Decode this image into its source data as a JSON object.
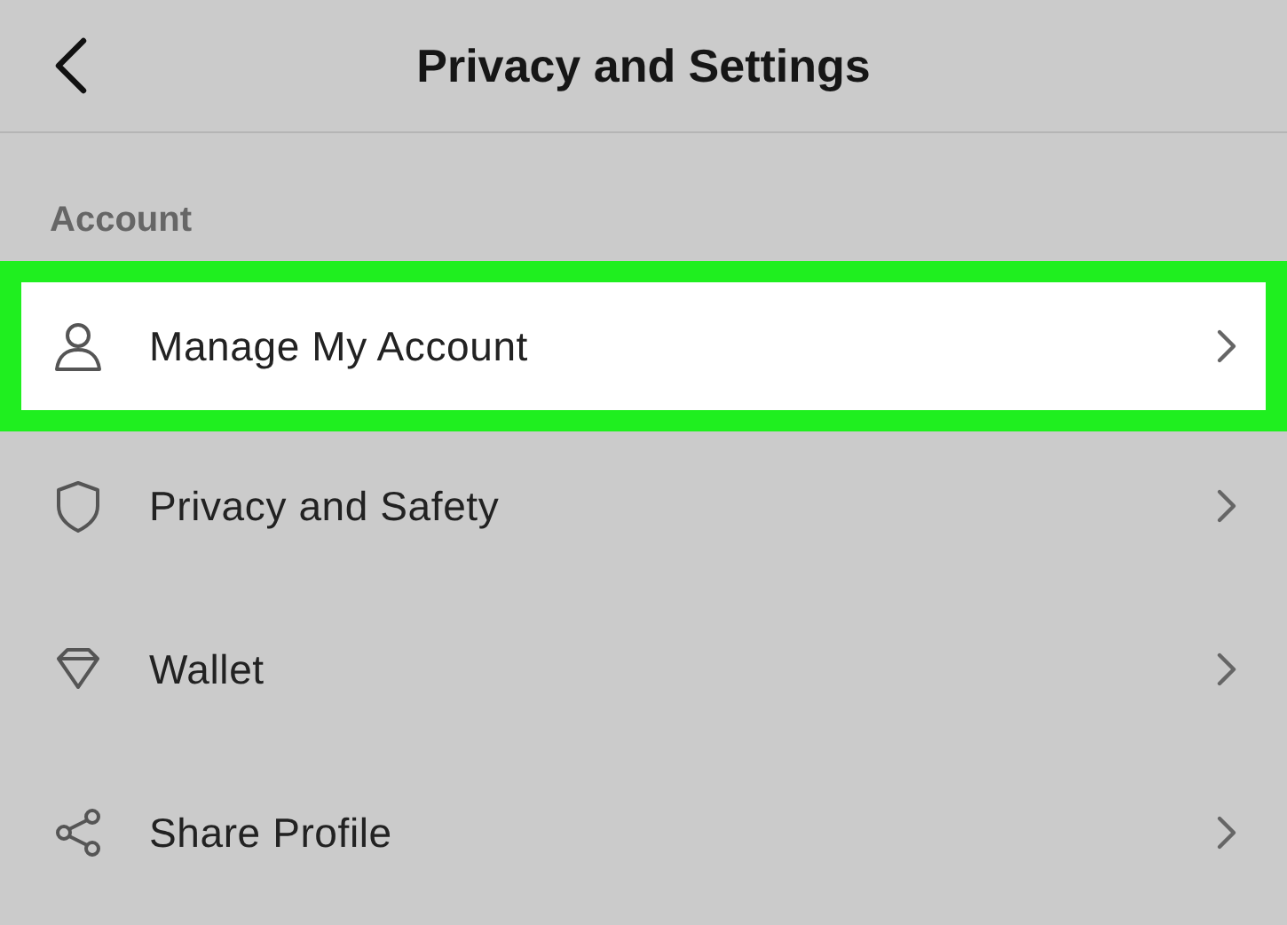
{
  "header": {
    "title": "Privacy and Settings"
  },
  "section": {
    "label": "Account"
  },
  "items": [
    {
      "kind": "person",
      "label": "Manage My Account",
      "highlighted": true
    },
    {
      "kind": "shield",
      "label": "Privacy and Safety",
      "highlighted": false
    },
    {
      "kind": "diamond",
      "label": "Wallet",
      "highlighted": false
    },
    {
      "kind": "share",
      "label": "Share Profile",
      "highlighted": false
    }
  ]
}
